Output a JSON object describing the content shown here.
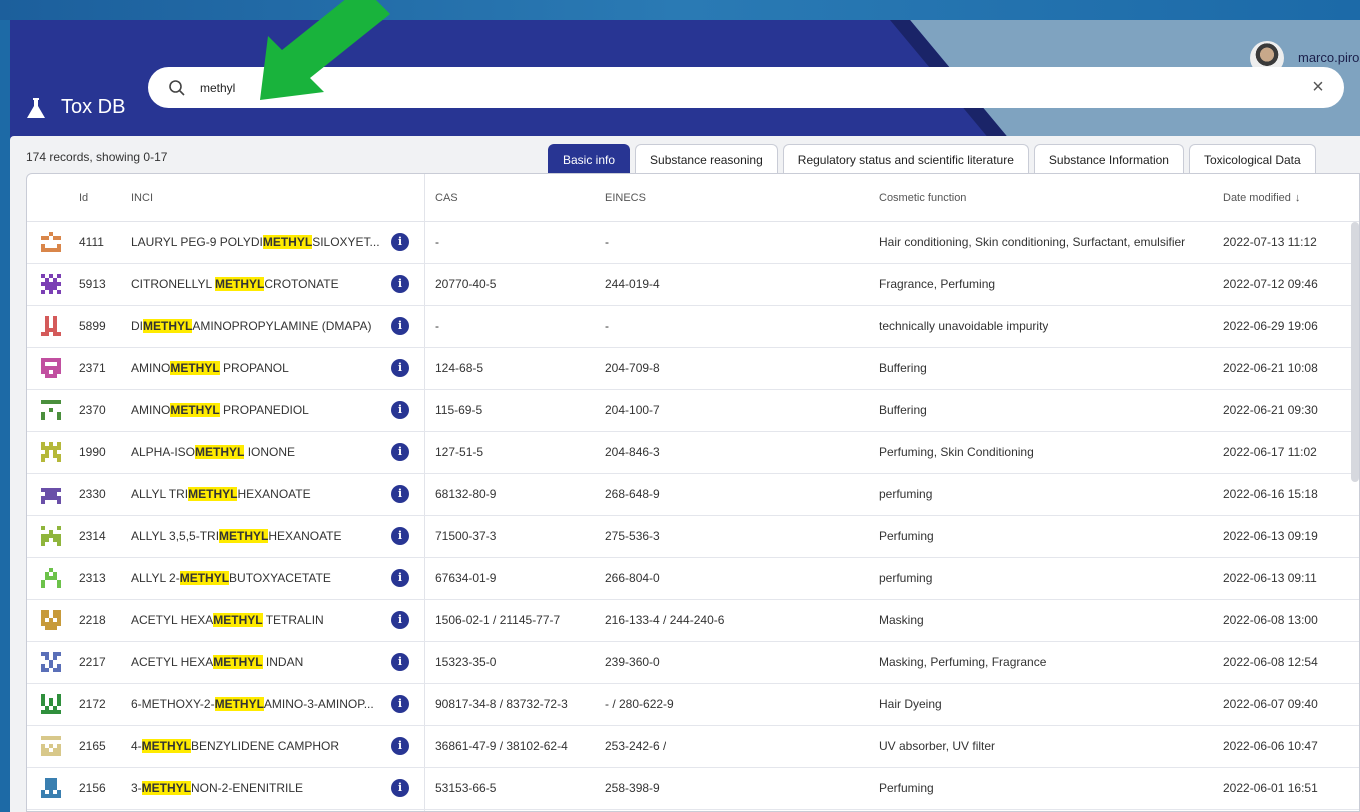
{
  "app": {
    "title": "Tox DB",
    "user": "marco.pirozz"
  },
  "search": {
    "value": "methyl",
    "highlight": "METHYL"
  },
  "records_text": "174 records, showing 0-17",
  "tabs": [
    {
      "label": "Basic info",
      "active": true
    },
    {
      "label": "Substance reasoning",
      "active": false
    },
    {
      "label": "Regulatory status and scientific literature",
      "active": false
    },
    {
      "label": "Substance Information",
      "active": false
    },
    {
      "label": "Toxicological Data",
      "active": false
    }
  ],
  "columns": {
    "id": "Id",
    "inci": "INCI",
    "cas": "CAS",
    "einecs": "EINECS",
    "function": "Cosmetic function",
    "date": "Date modified"
  },
  "rows": [
    {
      "id": "4111",
      "pre": "LAURYL PEG-9 POLYDI",
      "match": "METHYL",
      "post": "SILOXYET...",
      "cas": "-",
      "einecs": "-",
      "function": "Hair conditioning, Skin conditioning, Surfactant, emulsifier",
      "date": "2022-07-13 11:12",
      "color": "#d9864a"
    },
    {
      "id": "5913",
      "pre": "CITRONELLYL ",
      "match": "METHYL",
      "post": "CROTONATE",
      "cas": "20770-40-5",
      "einecs": "244-019-4",
      "function": "Fragrance, Perfuming",
      "date": "2022-07-12 09:46",
      "color": "#7b3fb4"
    },
    {
      "id": "5899",
      "pre": "DI",
      "match": "METHYL",
      "post": "AMINOPROPYLAMINE (DMAPA)",
      "cas": "-",
      "einecs": "-",
      "function": "technically unavoidable impurity",
      "date": "2022-06-29 19:06",
      "color": "#d45a5a"
    },
    {
      "id": "2371",
      "pre": "AMINO",
      "match": "METHYL",
      "post": " PROPANOL",
      "cas": "124-68-5",
      "einecs": "204-709-8",
      "function": "Buffering",
      "date": "2022-06-21 10:08",
      "color": "#c14fa0"
    },
    {
      "id": "2370",
      "pre": "AMINO",
      "match": "METHYL",
      "post": " PROPANEDIOL",
      "cas": "115-69-5",
      "einecs": "204-100-7",
      "function": "Buffering",
      "date": "2022-06-21 09:30",
      "color": "#4a8f3c"
    },
    {
      "id": "1990",
      "pre": "ALPHA-ISO",
      "match": "METHYL",
      "post": " IONONE",
      "cas": "127-51-5",
      "einecs": "204-846-3",
      "function": "Perfuming, Skin Conditioning",
      "date": "2022-06-17 11:02",
      "color": "#b5b83a"
    },
    {
      "id": "2330",
      "pre": "ALLYL TRI",
      "match": "METHYL",
      "post": "HEXANOATE",
      "cas": "68132-80-9",
      "einecs": "268-648-9",
      "function": "perfuming",
      "date": "2022-06-16 15:18",
      "color": "#6a4fa8"
    },
    {
      "id": "2314",
      "pre": "ALLYL 3,5,5-TRI",
      "match": "METHYL",
      "post": "HEXANOATE",
      "cas": "71500-37-3",
      "einecs": "275-536-3",
      "function": "Perfuming",
      "date": "2022-06-13 09:19",
      "color": "#8fb53c"
    },
    {
      "id": "2313",
      "pre": "ALLYL 2-",
      "match": "METHYL",
      "post": "BUTOXYACETATE",
      "cas": "67634-01-9",
      "einecs": "266-804-0",
      "function": "perfuming",
      "date": "2022-06-13 09:11",
      "color": "#6cc24a"
    },
    {
      "id": "2218",
      "pre": "ACETYL HEXA",
      "match": "METHYL",
      "post": " TETRALIN",
      "cas": "1506-02-1 / 21145-77-7",
      "einecs": "216-133-4 / 244-240-6",
      "function": "Masking",
      "date": "2022-06-08 13:00",
      "color": "#c79a3a"
    },
    {
      "id": "2217",
      "pre": "ACETYL HEXA",
      "match": "METHYL",
      "post": " INDAN",
      "cas": "15323-35-0",
      "einecs": "239-360-0",
      "function": "Masking, Perfuming, Fragrance",
      "date": "2022-06-08 12:54",
      "color": "#5a6fb8"
    },
    {
      "id": "2172",
      "pre": "6-METHOXY-2-",
      "match": "METHYL",
      "post": "AMINO-3-AMINOP...",
      "cas": "90817-34-8 / 83732-72-3",
      "einecs": "- / 280-622-9",
      "function": "Hair Dyeing",
      "date": "2022-06-07 09:40",
      "color": "#2f8f3c"
    },
    {
      "id": "2165",
      "pre": "4-",
      "match": "METHYL",
      "post": "BENZYLIDENE CAMPHOR",
      "cas": "36861-47-9 / 38102-62-4",
      "einecs": "253-242-6 /",
      "function": "UV absorber, UV filter",
      "date": "2022-06-06 10:47",
      "color": "#d8c88a"
    },
    {
      "id": "2156",
      "pre": "3-",
      "match": "METHYL",
      "post": "NON-2-ENENITRILE",
      "cas": "53153-66-5",
      "einecs": "258-398-9",
      "function": "Perfuming",
      "date": "2022-06-01 16:51",
      "color": "#3a7fb0"
    }
  ]
}
